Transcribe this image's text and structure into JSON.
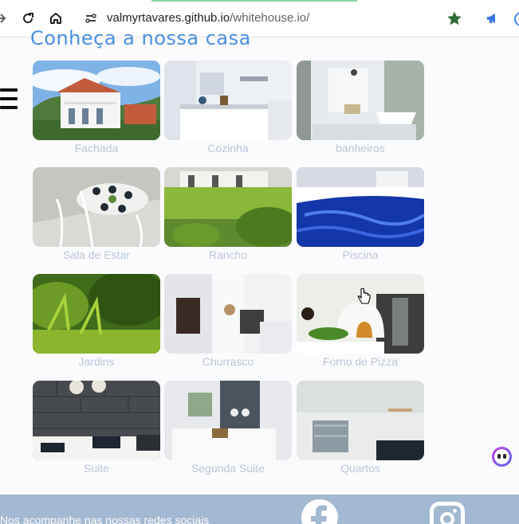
{
  "browser": {
    "url_host": "valmyrtavares.github.io",
    "url_path": "/whitehouse.io/"
  },
  "page": {
    "title": "Conheça a nossa casa"
  },
  "gallery": [
    {
      "caption": "Fachada"
    },
    {
      "caption": "Cozinha"
    },
    {
      "caption": "banheiros"
    },
    {
      "caption": "Sala de Estar"
    },
    {
      "caption": "Rancho"
    },
    {
      "caption": "Piscina"
    },
    {
      "caption": "Jardins"
    },
    {
      "caption": "Churrasco"
    },
    {
      "caption": "Forno de Pizza"
    },
    {
      "caption": "Suite"
    },
    {
      "caption": "Segunda Suite"
    },
    {
      "caption": "Quartos"
    }
  ],
  "footer": {
    "text": "Nos acompanhe nas nossas redes sociais"
  },
  "colors": {
    "title": "#4a8fe0",
    "caption": "#b9c6d8",
    "footer_bg": "#a3b8d1",
    "star": "#2e6b3a"
  }
}
